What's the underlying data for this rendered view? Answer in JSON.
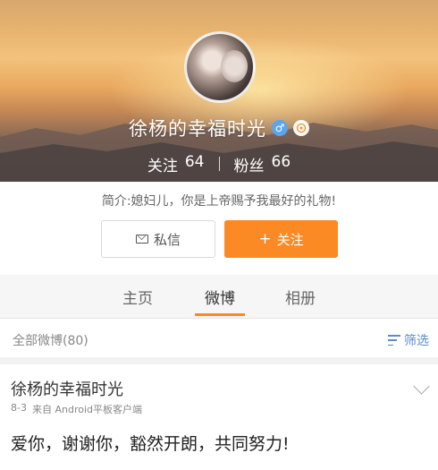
{
  "profile": {
    "name": "徐杨的幸福时光",
    "gender_symbol": "♂",
    "follow_label": "关注",
    "follow_count": "64",
    "fans_label": "粉丝",
    "fans_count": "66",
    "intro": "简介:媳妇儿，你是上帝赐予我最好的礼物!"
  },
  "actions": {
    "message_label": "私信",
    "follow_button_label": "关注",
    "follow_plus": "+"
  },
  "tabs": [
    {
      "label": "主页"
    },
    {
      "label": "微博",
      "active": true
    },
    {
      "label": "相册"
    }
  ],
  "filter": {
    "all_label": "全部微博(80)",
    "filter_label": "筛选"
  },
  "post": {
    "author": "徐杨的幸福时光",
    "date": "8-3",
    "source": "来自 Android平板客户端",
    "text": "爱你，谢谢你，豁然开朗，共同努力!"
  },
  "colors": {
    "accent": "#fb8a24",
    "link": "#5b8cc9",
    "gender": "#5ea4e8"
  }
}
